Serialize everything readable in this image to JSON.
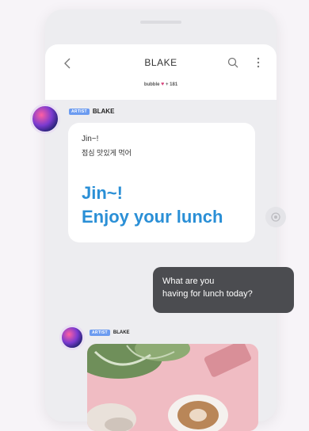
{
  "header": {
    "title": "BLAKE",
    "subscriber_name": "bubble",
    "subscriber_days": "+ 181"
  },
  "messages": [
    {
      "sender_badge": "ARTIST",
      "sender_name": "BLAKE",
      "line1": "Jin~!",
      "line2": "점심 맛있게 먹어",
      "big_line1": "Jin~!",
      "big_line2": "Enjoy your lunch"
    },
    {
      "user_line1": "What are you",
      "user_line2": "having for lunch today?"
    },
    {
      "sender_badge": "ARTIST",
      "sender_name": "BLAKE"
    }
  ],
  "colors": {
    "accent_blue": "#2a8fd6",
    "badge_blue": "#6b9bf0",
    "user_bubble": "#4b4c50",
    "heart": "#d6417a"
  }
}
